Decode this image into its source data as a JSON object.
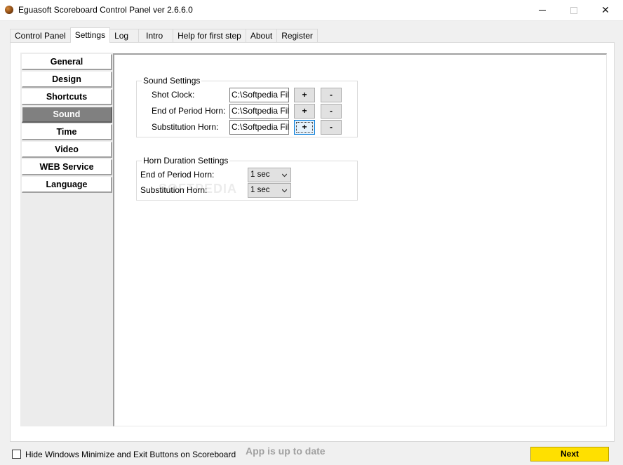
{
  "window": {
    "title": "Eguasoft Scoreboard Control Panel ver 2.6.6.0",
    "minimize_glyph": "",
    "close_glyph": "✕"
  },
  "tabs": [
    {
      "label": "Control Panel"
    },
    {
      "label": "Settings"
    },
    {
      "label": "Log"
    },
    {
      "label": "Intro"
    },
    {
      "label": "Help for first step"
    },
    {
      "label": "About"
    },
    {
      "label": "Register"
    }
  ],
  "active_tab": "Settings",
  "sidebar": {
    "items": [
      {
        "label": "General"
      },
      {
        "label": "Design"
      },
      {
        "label": "Shortcuts"
      },
      {
        "label": "Sound"
      },
      {
        "label": "Time"
      },
      {
        "label": "Video"
      },
      {
        "label": "WEB Service"
      },
      {
        "label": "Language"
      }
    ],
    "active": "Sound"
  },
  "sound_settings": {
    "title": "Sound Settings",
    "rows": [
      {
        "label": "Shot Clock:",
        "path": "C:\\Softpedia Files\\",
        "add": "+",
        "remove": "-"
      },
      {
        "label": "End of Period Horn:",
        "path": "C:\\Softpedia Files\\",
        "add": "+",
        "remove": "-"
      },
      {
        "label": "Substitution Horn:",
        "path": "C:\\Softpedia Files\\",
        "add": "+",
        "remove": "-"
      }
    ]
  },
  "horn_duration": {
    "title": "Horn Duration Settings",
    "rows": [
      {
        "label": "End of Period Horn:",
        "value": "1 sec"
      },
      {
        "label": "Substitution Horn:",
        "value": "1 sec"
      }
    ]
  },
  "watermark": "SOFTPEDIA",
  "footer": {
    "hide_buttons_label": "Hide Windows Minimize and Exit Buttons on Scoreboard",
    "hide_buttons_checked": false,
    "status": "App is up to date",
    "next_label": "Next"
  },
  "colors": {
    "next_button": "#ffe000",
    "sidebar_active": "#808080",
    "focus_border": "#0078d7"
  }
}
